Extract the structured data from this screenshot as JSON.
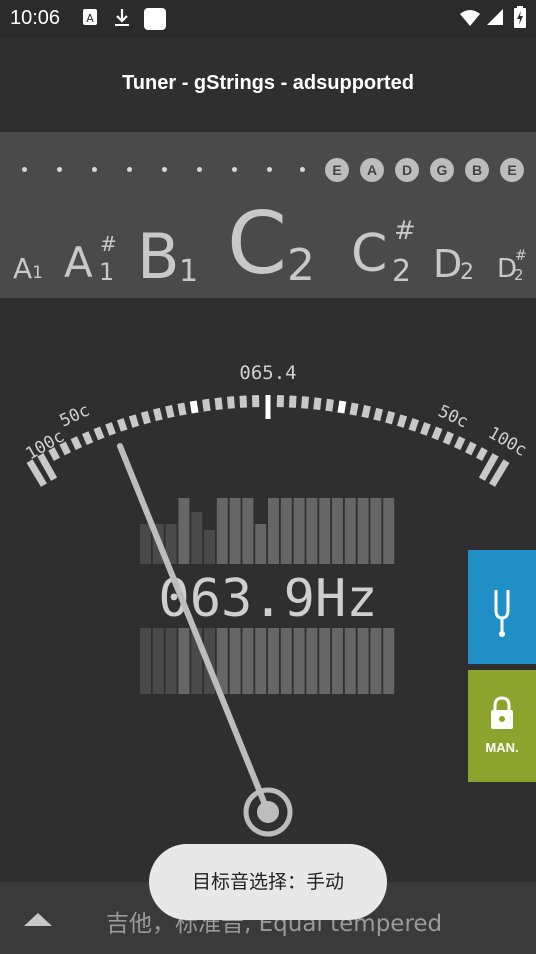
{
  "status": {
    "time": "10:06"
  },
  "app": {
    "title": "Tuner - gStrings - adsupported"
  },
  "strings": [
    "E",
    "A",
    "D",
    "G",
    "B",
    "E"
  ],
  "notes": [
    {
      "letter": "A",
      "sharp": "",
      "octave": "1"
    },
    {
      "letter": "A",
      "sharp": "#",
      "octave": "1"
    },
    {
      "letter": "B",
      "sharp": "",
      "octave": "1"
    },
    {
      "letter": "C",
      "sharp": "",
      "octave": "2"
    },
    {
      "letter": "C",
      "sharp": "#",
      "octave": "2"
    },
    {
      "letter": "D",
      "sharp": "",
      "octave": "2"
    },
    {
      "letter": "D",
      "sharp": "#",
      "octave": "2"
    }
  ],
  "gauge": {
    "target_freq": "065.4",
    "left_100": "100c",
    "left_50": "50c",
    "right_50": "50c",
    "right_100": "100c",
    "frequency": "063.9Hz"
  },
  "buttons": {
    "man_label": "MAN."
  },
  "bottom": {
    "tuning": "吉他，标准音, Equal tempered"
  },
  "toast": {
    "text": "目标音选择：手动"
  },
  "colors": {
    "fork_button": "#1f8fc6",
    "manual_button": "#8ca42d",
    "toast_bg": "#e8e8e8"
  }
}
